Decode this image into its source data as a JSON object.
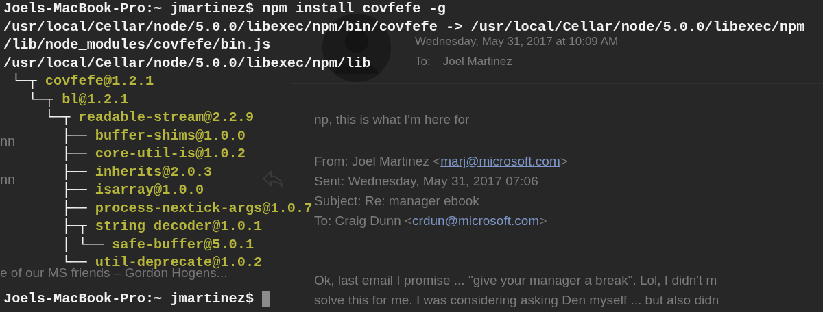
{
  "mail": {
    "message_list": [
      {
        "sender": "nn"
      },
      {
        "sender": "nn"
      }
    ],
    "preview": "e of our MS friends – Gordon Hogens...",
    "message": {
      "date": "Wednesday, May 31, 2017 at 10:09 AM",
      "to_label": "To:",
      "to": "Joel Martinez",
      "body": [
        {
          "kind": "text",
          "text": "np, this is what I'm here for"
        },
        {
          "kind": "rule"
        },
        {
          "kind": "header",
          "before": "From: Joel Martinez <",
          "link": "marj@microsoft.com",
          "after": ">"
        },
        {
          "kind": "text",
          "text": "Sent: Wednesday, May 31, 2017 07:06"
        },
        {
          "kind": "text",
          "text": "Subject: Re: manager ebook"
        },
        {
          "kind": "header",
          "before": "To: Craig Dunn <",
          "link": "crdun@microsoft.com",
          "after": ">"
        },
        {
          "kind": "gap"
        },
        {
          "kind": "text",
          "text": "Ok, last email I promise ... \"give your manager a break\". Lol, I didn't m"
        },
        {
          "kind": "text",
          "text": "solve this for me. I was considering asking Den myself ... but also didn"
        }
      ]
    }
  },
  "terminal": {
    "command_line": {
      "prompt": "Joels-MacBook-Pro:~ jmartinez$",
      "command": "npm install covfefe -g"
    },
    "output": [
      "/usr/local/Cellar/node/5.0.0/libexec/npm/bin/covfefe -> /usr/local/Cellar/node/5.0.0/libexec/npm",
      "/lib/node_modules/covfefe/bin.js",
      "/usr/local/Cellar/node/5.0.0/libexec/npm/lib"
    ],
    "tree": [
      {
        "prefix": "└─┬",
        "name": "covfefe@1.2.1",
        "children": [
          {
            "prefix": "└─┬",
            "name": "bl@1.2.1",
            "children": [
              {
                "prefix": "└─┬",
                "name": "readable-stream@2.2.9",
                "children": [
                  {
                    "prefix": "├──",
                    "name": "buffer-shims@1.0.0"
                  },
                  {
                    "prefix": "├──",
                    "name": "core-util-is@1.0.2"
                  },
                  {
                    "prefix": "├──",
                    "name": "inherits@2.0.3"
                  },
                  {
                    "prefix": "├──",
                    "name": "isarray@1.0.0"
                  },
                  {
                    "prefix": "├──",
                    "name": "process-nextick-args@1.0.7"
                  },
                  {
                    "prefix": "├─┬",
                    "name": "string_decoder@1.0.1",
                    "children": [
                      {
                        "prefix": "│ └──",
                        "name": "safe-buffer@5.0.1"
                      }
                    ]
                  },
                  {
                    "prefix": "└──",
                    "name": "util-deprecate@1.0.2"
                  }
                ]
              }
            ]
          }
        ]
      }
    ],
    "prompt_line": {
      "prompt": "Joels-MacBook-Pro:~ jmartinez$",
      "cursor": true
    }
  }
}
